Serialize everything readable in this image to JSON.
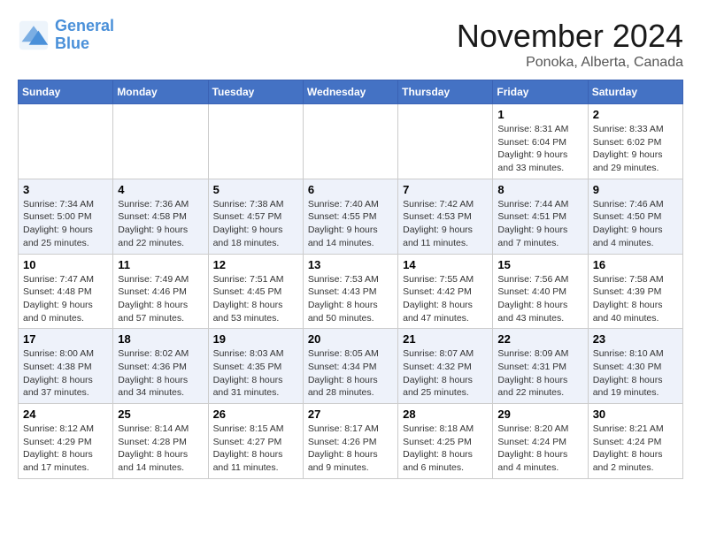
{
  "header": {
    "logo_line1": "General",
    "logo_line2": "Blue",
    "month_title": "November 2024",
    "location": "Ponoka, Alberta, Canada"
  },
  "days_of_week": [
    "Sunday",
    "Monday",
    "Tuesday",
    "Wednesday",
    "Thursday",
    "Friday",
    "Saturday"
  ],
  "weeks": [
    [
      {
        "day": "",
        "info": ""
      },
      {
        "day": "",
        "info": ""
      },
      {
        "day": "",
        "info": ""
      },
      {
        "day": "",
        "info": ""
      },
      {
        "day": "",
        "info": ""
      },
      {
        "day": "1",
        "info": "Sunrise: 8:31 AM\nSunset: 6:04 PM\nDaylight: 9 hours and 33 minutes."
      },
      {
        "day": "2",
        "info": "Sunrise: 8:33 AM\nSunset: 6:02 PM\nDaylight: 9 hours and 29 minutes."
      }
    ],
    [
      {
        "day": "3",
        "info": "Sunrise: 7:34 AM\nSunset: 5:00 PM\nDaylight: 9 hours and 25 minutes."
      },
      {
        "day": "4",
        "info": "Sunrise: 7:36 AM\nSunset: 4:58 PM\nDaylight: 9 hours and 22 minutes."
      },
      {
        "day": "5",
        "info": "Sunrise: 7:38 AM\nSunset: 4:57 PM\nDaylight: 9 hours and 18 minutes."
      },
      {
        "day": "6",
        "info": "Sunrise: 7:40 AM\nSunset: 4:55 PM\nDaylight: 9 hours and 14 minutes."
      },
      {
        "day": "7",
        "info": "Sunrise: 7:42 AM\nSunset: 4:53 PM\nDaylight: 9 hours and 11 minutes."
      },
      {
        "day": "8",
        "info": "Sunrise: 7:44 AM\nSunset: 4:51 PM\nDaylight: 9 hours and 7 minutes."
      },
      {
        "day": "9",
        "info": "Sunrise: 7:46 AM\nSunset: 4:50 PM\nDaylight: 9 hours and 4 minutes."
      }
    ],
    [
      {
        "day": "10",
        "info": "Sunrise: 7:47 AM\nSunset: 4:48 PM\nDaylight: 9 hours and 0 minutes."
      },
      {
        "day": "11",
        "info": "Sunrise: 7:49 AM\nSunset: 4:46 PM\nDaylight: 8 hours and 57 minutes."
      },
      {
        "day": "12",
        "info": "Sunrise: 7:51 AM\nSunset: 4:45 PM\nDaylight: 8 hours and 53 minutes."
      },
      {
        "day": "13",
        "info": "Sunrise: 7:53 AM\nSunset: 4:43 PM\nDaylight: 8 hours and 50 minutes."
      },
      {
        "day": "14",
        "info": "Sunrise: 7:55 AM\nSunset: 4:42 PM\nDaylight: 8 hours and 47 minutes."
      },
      {
        "day": "15",
        "info": "Sunrise: 7:56 AM\nSunset: 4:40 PM\nDaylight: 8 hours and 43 minutes."
      },
      {
        "day": "16",
        "info": "Sunrise: 7:58 AM\nSunset: 4:39 PM\nDaylight: 8 hours and 40 minutes."
      }
    ],
    [
      {
        "day": "17",
        "info": "Sunrise: 8:00 AM\nSunset: 4:38 PM\nDaylight: 8 hours and 37 minutes."
      },
      {
        "day": "18",
        "info": "Sunrise: 8:02 AM\nSunset: 4:36 PM\nDaylight: 8 hours and 34 minutes."
      },
      {
        "day": "19",
        "info": "Sunrise: 8:03 AM\nSunset: 4:35 PM\nDaylight: 8 hours and 31 minutes."
      },
      {
        "day": "20",
        "info": "Sunrise: 8:05 AM\nSunset: 4:34 PM\nDaylight: 8 hours and 28 minutes."
      },
      {
        "day": "21",
        "info": "Sunrise: 8:07 AM\nSunset: 4:32 PM\nDaylight: 8 hours and 25 minutes."
      },
      {
        "day": "22",
        "info": "Sunrise: 8:09 AM\nSunset: 4:31 PM\nDaylight: 8 hours and 22 minutes."
      },
      {
        "day": "23",
        "info": "Sunrise: 8:10 AM\nSunset: 4:30 PM\nDaylight: 8 hours and 19 minutes."
      }
    ],
    [
      {
        "day": "24",
        "info": "Sunrise: 8:12 AM\nSunset: 4:29 PM\nDaylight: 8 hours and 17 minutes."
      },
      {
        "day": "25",
        "info": "Sunrise: 8:14 AM\nSunset: 4:28 PM\nDaylight: 8 hours and 14 minutes."
      },
      {
        "day": "26",
        "info": "Sunrise: 8:15 AM\nSunset: 4:27 PM\nDaylight: 8 hours and 11 minutes."
      },
      {
        "day": "27",
        "info": "Sunrise: 8:17 AM\nSunset: 4:26 PM\nDaylight: 8 hours and 9 minutes."
      },
      {
        "day": "28",
        "info": "Sunrise: 8:18 AM\nSunset: 4:25 PM\nDaylight: 8 hours and 6 minutes."
      },
      {
        "day": "29",
        "info": "Sunrise: 8:20 AM\nSunset: 4:24 PM\nDaylight: 8 hours and 4 minutes."
      },
      {
        "day": "30",
        "info": "Sunrise: 8:21 AM\nSunset: 4:24 PM\nDaylight: 8 hours and 2 minutes."
      }
    ]
  ]
}
